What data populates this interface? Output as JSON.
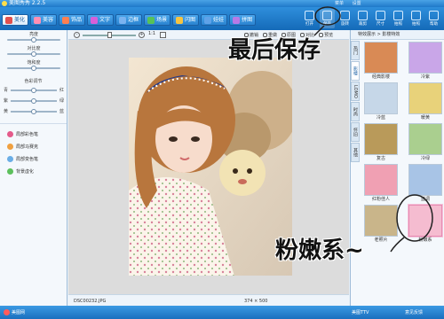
{
  "app": {
    "title": "美图秀秀 2.2.5",
    "title_links": [
      "菜单",
      "设置"
    ]
  },
  "tabs": [
    {
      "label": "美化",
      "active": true,
      "color": "#e0504d"
    },
    {
      "label": "美容",
      "active": false,
      "color": "#ff8fb3"
    },
    {
      "label": "饰品",
      "active": false,
      "color": "#ff7f50"
    },
    {
      "label": "文字",
      "active": false,
      "color": "#d85fd8"
    },
    {
      "label": "边框",
      "active": false,
      "color": "#7ab3f0"
    },
    {
      "label": "场景",
      "active": false,
      "color": "#57c257"
    },
    {
      "label": "闪图",
      "active": false,
      "color": "#f7c440"
    },
    {
      "label": "娃娃",
      "active": false,
      "color": "#5fa2e8"
    },
    {
      "label": "拼图",
      "active": false,
      "color": "#b879e6"
    }
  ],
  "toolbar": [
    "打开",
    "保存",
    "旋转",
    "裁剪",
    "尺寸",
    "拍照",
    "拍照",
    "帮助"
  ],
  "left": {
    "sliders": [
      "亮度",
      "对比度",
      "饱和度"
    ],
    "color_title": "色彩调节",
    "color_rows": [
      [
        "青",
        "红"
      ],
      [
        "紫",
        "绿"
      ],
      [
        "黄",
        "蓝"
      ]
    ],
    "brushes": [
      {
        "label": "局部彩色笔",
        "color": "#e45a8a"
      },
      {
        "label": "局部马赛克",
        "color": "#f0a040"
      },
      {
        "label": "局部变色笔",
        "color": "#6aaee6"
      },
      {
        "label": "背景虚化",
        "color": "#5cc05c"
      }
    ]
  },
  "canvas": {
    "zoom_label": "1:1",
    "actions": [
      "撤销",
      "重做",
      "原图",
      "对比",
      "预览"
    ],
    "filename": "DSC00232.JPG",
    "dimensions": "374 × 500"
  },
  "right": {
    "breadcrumb": "特效展示 > 影楼特效",
    "vtabs": [
      "热门",
      "影楼",
      "LOMO",
      "时尚",
      "怀旧",
      "其他"
    ],
    "effects": [
      {
        "label": "经典影楼",
        "tint": "#d98a55"
      },
      {
        "label": "冷紫",
        "tint": "#c9a6e8"
      },
      {
        "label": "冷蓝",
        "tint": "#c6d7e8"
      },
      {
        "label": "暖黄",
        "tint": "#e8d27a"
      },
      {
        "label": "复古",
        "tint": "#b99a5a"
      },
      {
        "label": "冷绿",
        "tint": "#aacf8f"
      },
      {
        "label": "红粉佳人",
        "tint": "#f0a0b3"
      },
      {
        "label": "蓝调",
        "tint": "#a8c4e6"
      },
      {
        "label": "老照片",
        "tint": "#c9b58a"
      },
      {
        "label": "粉嫩系",
        "tint": "#f5bcd0",
        "selected": true
      }
    ]
  },
  "annotations": {
    "save": "最后保存",
    "pink": "粉嫩系~"
  },
  "taskbar": {
    "site": "美图网",
    "ttv": "美图TTV",
    "feedback": "意见反馈"
  }
}
